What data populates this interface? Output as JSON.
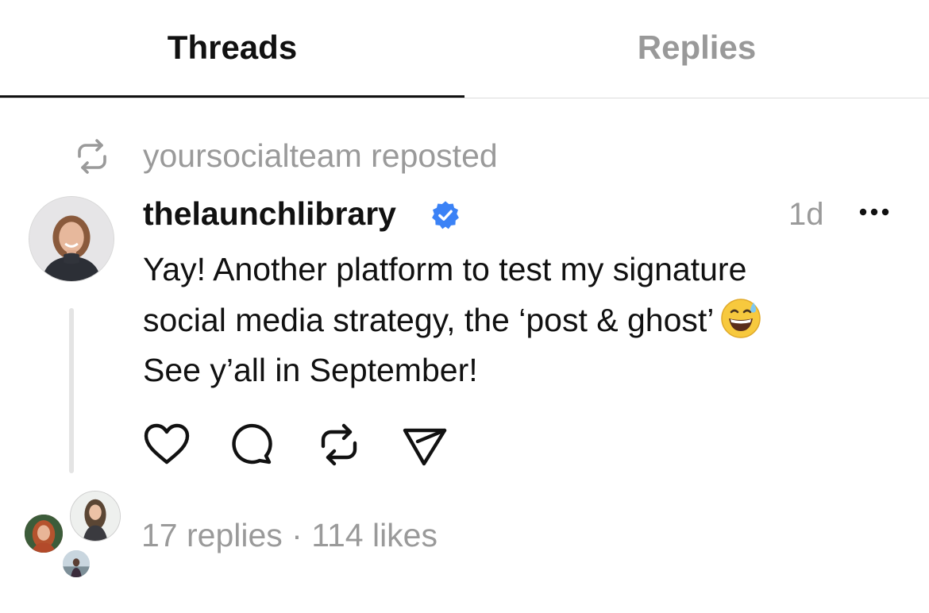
{
  "tabs": [
    {
      "label": "Threads",
      "active": true
    },
    {
      "label": "Replies",
      "active": false
    }
  ],
  "repost": {
    "text": "yoursocialteam reposted",
    "icon": "repost-icon"
  },
  "post": {
    "username": "thelaunchlibrary",
    "verified": true,
    "timestamp": "1d",
    "lines": [
      "Yay! Another platform to test my signature",
      "social media strategy, the ‘post & ghost’",
      "See y’all in September!"
    ],
    "emoji": "😅",
    "actions": [
      "heart-icon",
      "comment-icon",
      "repost-icon",
      "share-icon"
    ]
  },
  "stats": {
    "text": "17 replies · 114 likes"
  },
  "colors": {
    "primary_text": "#111111",
    "secondary_text": "#9a9a9a",
    "verified_blue": "#3b82f6",
    "divider": "#dcdcdc"
  }
}
